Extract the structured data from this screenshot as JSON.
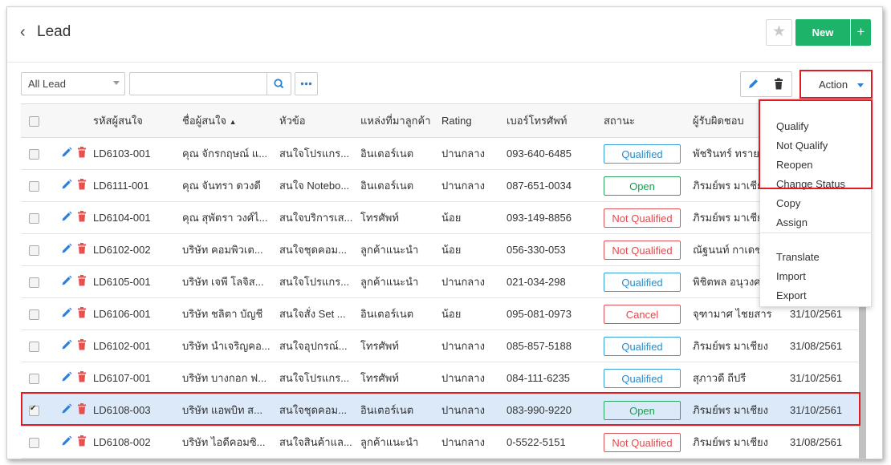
{
  "header": {
    "title": "Lead",
    "new_label": "New",
    "plus_label": "+"
  },
  "toolbar": {
    "filter_value": "All Lead",
    "search_value": "",
    "action_label": "Action"
  },
  "table": {
    "columns": [
      "รหัสผู้สนใจ",
      "ชื่อผู้สนใจ",
      "หัวข้อ",
      "แหล่งที่มาลูกค้า",
      "Rating",
      "เบอร์โทรศัพท์",
      "สถานะ",
      "ผู้รับผิดชอบ"
    ],
    "sort_indicator": "▲",
    "rows": [
      {
        "code": "LD6103-001",
        "name": "คุณ จักรกฤษณ์ แ...",
        "topic": "สนใจโปรแกร...",
        "source": "อินเตอร์เนต",
        "rating": "ปานกลาง",
        "phone": "093-640-6485",
        "status": "Qualified",
        "status_kind": "blue",
        "owner": "พัชรินทร์ ทราย",
        "date": "",
        "selected": false
      },
      {
        "code": "LD6111-001",
        "name": "คุณ จันทรา ดวงดี",
        "topic": "สนใจ Notebo...",
        "source": "อินเตอร์เนต",
        "rating": "ปานกลาง",
        "phone": "087-651-0034",
        "status": "Open",
        "status_kind": "green",
        "owner": "ภิรมย์พร มาเชีย",
        "date": "",
        "selected": false
      },
      {
        "code": "LD6104-001",
        "name": "คุณ สุพัตรา วงศ์ไ...",
        "topic": "สนใจบริการเส...",
        "source": "โทรศัพท์",
        "rating": "น้อย",
        "phone": "093-149-8856",
        "status": "Not Qualified",
        "status_kind": "red",
        "owner": "ภิรมย์พร มาเชีย",
        "date": "",
        "selected": false
      },
      {
        "code": "LD6102-002",
        "name": "บริษัท คอมพิวเต...",
        "topic": "สนใจชุดคอม...",
        "source": "ลูกค้าแนะนำ",
        "rating": "น้อย",
        "phone": "056-330-053",
        "status": "Not Qualified",
        "status_kind": "red",
        "owner": "ณัฐนนท์ กาเดช",
        "date": "",
        "selected": false
      },
      {
        "code": "LD6105-001",
        "name": "บริษัท เจพี โลจิส...",
        "topic": "สนใจโปรแกร...",
        "source": "ลูกค้าแนะนำ",
        "rating": "ปานกลาง",
        "phone": "021-034-298",
        "status": "Qualified",
        "status_kind": "blue",
        "owner": "พิชิตพล อนุวงศ",
        "date": "",
        "selected": false
      },
      {
        "code": "LD6106-001",
        "name": "บริษัท ชลิตา บัญชี",
        "topic": "สนใจสั่ง Set ...",
        "source": "อินเตอร์เนต",
        "rating": "น้อย",
        "phone": "095-081-0973",
        "status": "Cancel",
        "status_kind": "red",
        "owner": "จุฑามาศ ไชยสาร",
        "date": "31/10/2561",
        "selected": false
      },
      {
        "code": "LD6102-001",
        "name": "บริษัท นำเจริญคอ...",
        "topic": "สนใจอุปกรณ์...",
        "source": "โทรศัพท์",
        "rating": "ปานกลาง",
        "phone": "085-857-5188",
        "status": "Qualified",
        "status_kind": "blue",
        "owner": "ภิรมย์พร มาเชียง",
        "date": "31/08/2561",
        "selected": false
      },
      {
        "code": "LD6107-001",
        "name": "บริษัท บางกอก ฟ...",
        "topic": "สนใจโปรแกร...",
        "source": "โทรศัพท์",
        "rating": "ปานกลาง",
        "phone": "084-111-6235",
        "status": "Qualified",
        "status_kind": "blue",
        "owner": "สุภาวดี ถีปรี",
        "date": "31/10/2561",
        "selected": false
      },
      {
        "code": "LD6108-003",
        "name": "บริษัท แอพบิท ส...",
        "topic": "สนใจชุดคอม...",
        "source": "อินเตอร์เนต",
        "rating": "ปานกลาง",
        "phone": "083-990-9220",
        "status": "Open",
        "status_kind": "green",
        "owner": "ภิรมย์พร มาเชียง",
        "date": "31/10/2561",
        "selected": true
      },
      {
        "code": "LD6108-002",
        "name": "บริษัท ไอดีคอมซิ...",
        "topic": "สนใจสินค้าแล...",
        "source": "ลูกค้าแนะนำ",
        "rating": "ปานกลาง",
        "phone": "0-5522-5151",
        "status": "Not Qualified",
        "status_kind": "red",
        "owner": "ภิรมย์พร มาเชียง",
        "date": "31/08/2561",
        "selected": false
      }
    ]
  },
  "action_menu": {
    "items": [
      "Qualify",
      "Not Qualify",
      "Reopen",
      "Change Status",
      "Copy",
      "Assign",
      "Translate",
      "Import",
      "Export"
    ]
  },
  "colors": {
    "accent_green": "#1db369",
    "highlight_red": "#e01b24",
    "link_blue": "#2d7fd3",
    "delete_red": "#e85050"
  }
}
